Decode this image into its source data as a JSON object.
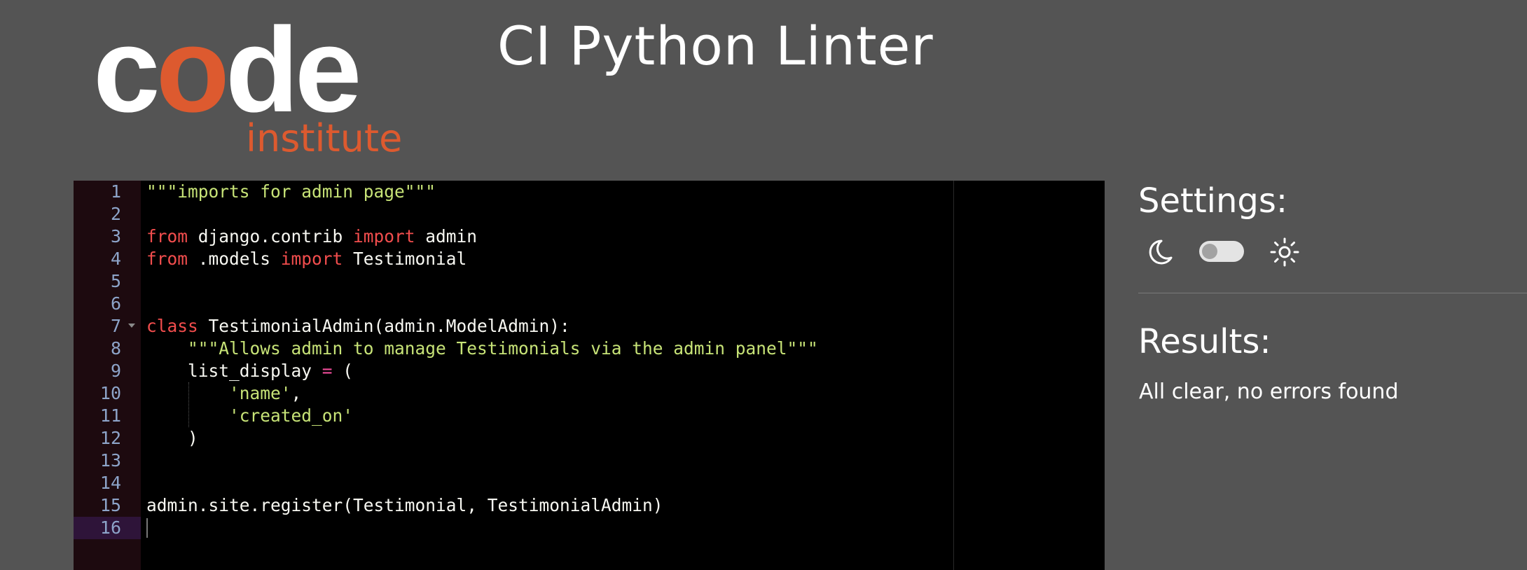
{
  "logo": {
    "word_c": "c",
    "word_o": "o",
    "word_de": "de",
    "subtitle": "institute"
  },
  "title": "CI Python Linter",
  "editor": {
    "lines": [
      {
        "n": "1"
      },
      {
        "n": "2"
      },
      {
        "n": "3"
      },
      {
        "n": "4"
      },
      {
        "n": "5"
      },
      {
        "n": "6"
      },
      {
        "n": "7"
      },
      {
        "n": "8"
      },
      {
        "n": "9"
      },
      {
        "n": "10"
      },
      {
        "n": "11"
      },
      {
        "n": "12"
      },
      {
        "n": "13"
      },
      {
        "n": "14"
      },
      {
        "n": "15"
      },
      {
        "n": "16"
      }
    ],
    "tokens": {
      "l1": "\"\"\"imports for admin page\"\"\"",
      "l3_from": "from",
      "l3_mod": " django.contrib ",
      "l3_import": "import",
      "l3_name": " admin",
      "l4_from": "from",
      "l4_mod": " .models ",
      "l4_import": "import",
      "l4_name": " Testimonial",
      "l7_class": "class",
      "l7_rest": " TestimonialAdmin(admin.ModelAdmin):",
      "l8_doc": "\"\"\"Allows admin to manage Testimonials via the admin panel\"\"\"",
      "l9_name": "list_display ",
      "l9_eq": "=",
      "l9_paren": " (",
      "l10_str": "'name'",
      "l10_comma": ",",
      "l11_str": "'created_on'",
      "l12_paren": ")",
      "l15": "admin.site.register(Testimonial, TestimonialAdmin)"
    }
  },
  "settings": {
    "title": "Settings:",
    "dark_icon": "moon-icon",
    "light_icon": "sun-icon",
    "theme_toggle": "off"
  },
  "results": {
    "title": "Results:",
    "message": "All clear, no errors found"
  },
  "colors": {
    "background": "#545454",
    "editor_bg": "#000000",
    "keyword": "#f14d4d",
    "string": "#c7e377",
    "operator": "#f14d9a",
    "brand_orange": "#dd5a2f"
  }
}
